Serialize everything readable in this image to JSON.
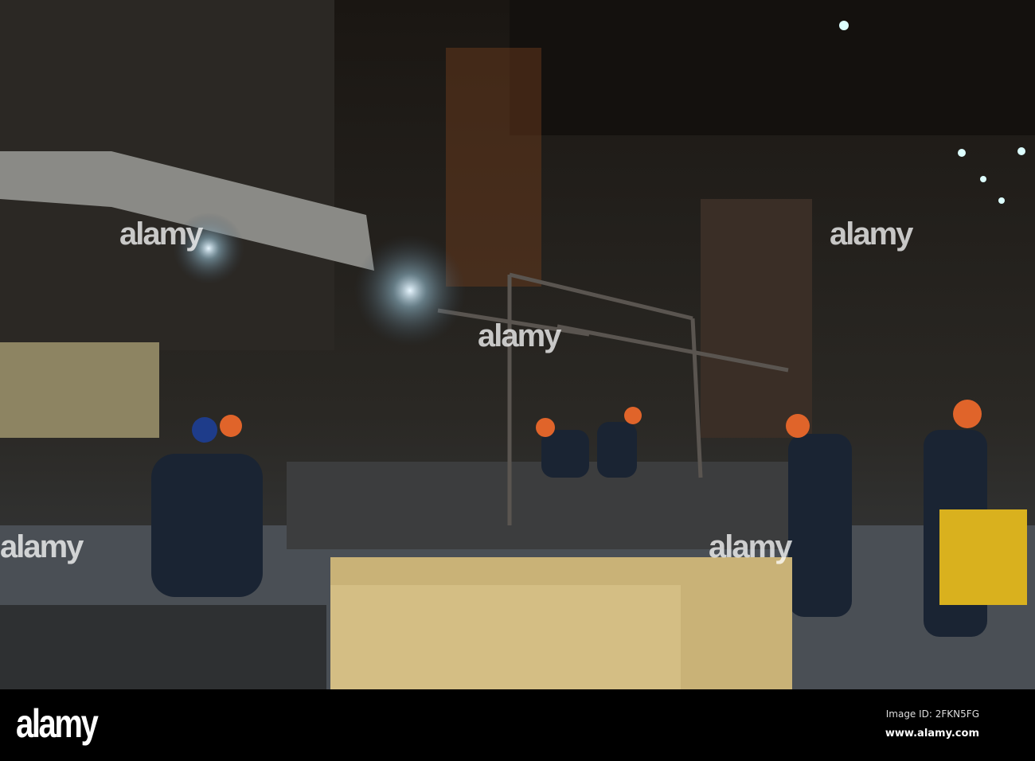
{
  "footer": {
    "logo": "alamy",
    "image_id": "Image ID: 2FKN5FG",
    "url": "www.alamy.com"
  },
  "watermark": "alamy"
}
